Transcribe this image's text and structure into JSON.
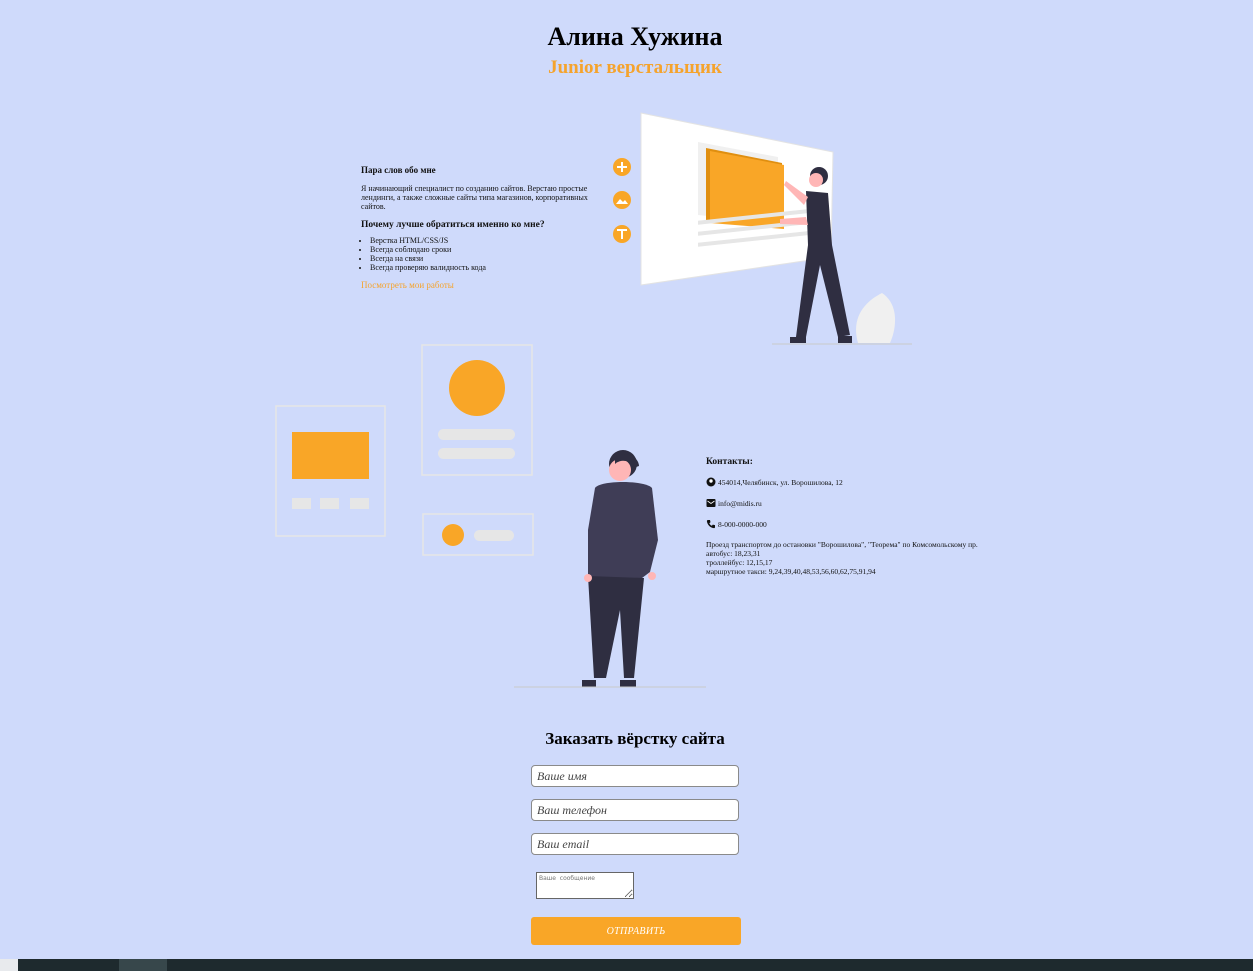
{
  "header": {
    "name": "Алина Хужина",
    "role": "Junior верстальщик"
  },
  "about": {
    "heading": "Пара слов обо мне",
    "text": "Я начинающий специалист по созданию сайтов. Верстаю простые лендинги, а также сложные сайты типа магазинов, корпоративных сайтов.",
    "why_heading": "Почему лучше обратиться именно ко мне?",
    "reasons": [
      "Верстка HTML/CSS/JS",
      "Всегда соблюдаю сроки",
      "Всегда на связи",
      "Всегда проверяю валидность кода"
    ],
    "works_link": "Посмотреть мои работы"
  },
  "contacts": {
    "heading": "Контакты:",
    "address": "454014,Челябинск, ул. Ворошилова, 12",
    "email": "info@midis.ru",
    "phone": "8-000-0000-000",
    "transport": [
      "Проезд транспортом до остановки \"Ворошилова\", \"Теорема\" по Комсомольскому пр.",
      "автобус: 18,23,31",
      "троллейбус: 12,15,17",
      "маршрутное такси: 9,24,39,40,48,53,56,60,62,75,91,94"
    ]
  },
  "order": {
    "title": "Заказать вёрстку сайта",
    "name_placeholder": "Ваше имя",
    "phone_placeholder": "Ваш телефон",
    "email_placeholder": "Ваш email",
    "message_placeholder": "Ваше  сообщение",
    "submit_label": "ОТПРАВИТЬ"
  },
  "colors": {
    "background": "#cfdafb",
    "accent": "#f9a627",
    "figure_dark": "#2f2e41"
  },
  "icons": [
    "location-icon",
    "mail-icon",
    "phone-icon",
    "plus-icon",
    "image-icon",
    "text-icon"
  ]
}
